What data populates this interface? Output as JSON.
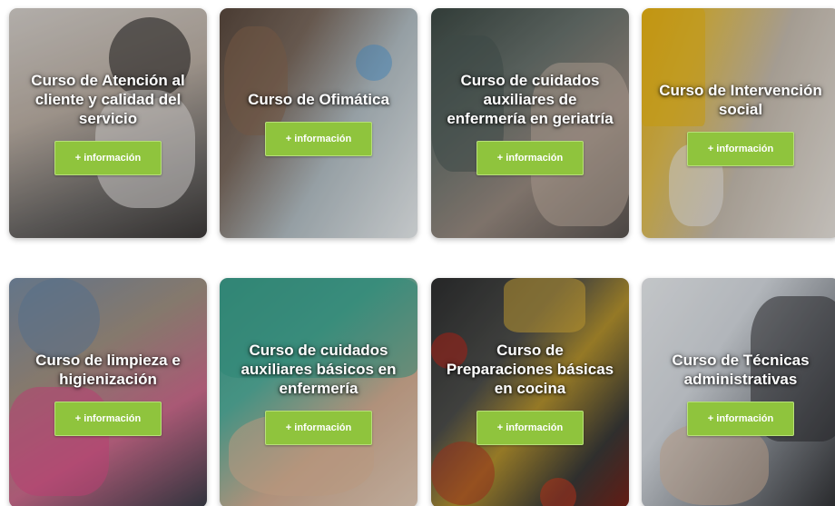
{
  "courses": [
    {
      "title": "Curso de Atención al cliente y calidad del servicio",
      "button_label": "+ información"
    },
    {
      "title": "Curso de Ofimática",
      "button_label": "+ información"
    },
    {
      "title": "Curso de cuidados auxiliares de enfermería en geriatría",
      "button_label": "+ información"
    },
    {
      "title": "Curso de Intervención social",
      "button_label": "+ información"
    },
    {
      "title": "Curso de limpieza e higienización",
      "button_label": "+ información"
    },
    {
      "title": "Curso de cuidados auxiliares básicos en enfermería",
      "button_label": "+ información"
    },
    {
      "title": "Curso de Preparaciones básicas en cocina",
      "button_label": "+ información"
    },
    {
      "title": "Curso de Técnicas administrativas",
      "button_label": "+ información"
    }
  ],
  "colors": {
    "button_green": "#8fc43d",
    "title_text": "#ffffff"
  }
}
